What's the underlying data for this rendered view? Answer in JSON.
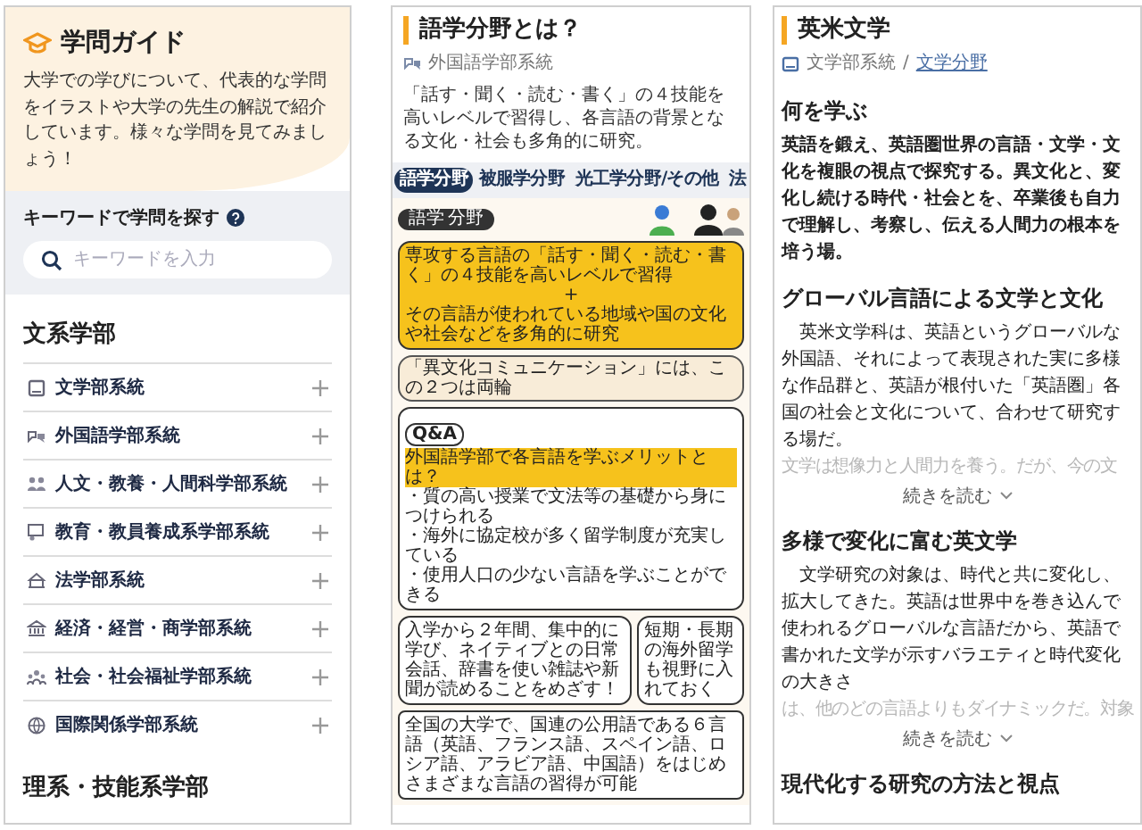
{
  "guide_panel": {
    "title": "学問ガイド",
    "description": "大学での学びについて、代表的な学問をイラストや大学の先生の解説で紹介しています。様々な学問を見てみましょう！",
    "search": {
      "label": "キーワードで学問を探す",
      "placeholder": "キーワードを入力"
    },
    "sections": [
      {
        "heading": "文系学部",
        "items": [
          {
            "label": "文学部系統",
            "expanded": false
          },
          {
            "label": "外国語学部系統",
            "expanded": false
          },
          {
            "label": "人文・教養・人間科学部系統",
            "expanded": false
          },
          {
            "label": "教育・教員養成系学部系統",
            "expanded": false
          },
          {
            "label": "法学部系統",
            "expanded": false
          },
          {
            "label": "経済・経営・商学部系統",
            "expanded": false
          },
          {
            "label": "社会・社会福祉学部系統",
            "expanded": false
          },
          {
            "label": "国際関係学部系統",
            "expanded": false
          }
        ]
      },
      {
        "heading": "理系・技能系学部"
      }
    ]
  },
  "field_panel": {
    "title": "語学分野とは？",
    "breadcrumb": "外国語学部系統",
    "description": "「話す・聞く・読む・書く」の４技能を高いレベルで習得し、各言語の背景となる文化・社会も多角的に研究。",
    "tabs": [
      {
        "label": "語学分野",
        "selected": true
      },
      {
        "label": "被服学分野",
        "selected": false
      },
      {
        "label": "光工学分野/その他",
        "selected": false
      },
      {
        "label": "法",
        "selected": false
      }
    ],
    "infographic": {
      "tag": "語学",
      "tag_suffix": "分野",
      "skill_text": "専攻する言語の「話す・聞く・読む・書く」の４技能を高いレベルで習得",
      "plus": "+",
      "culture_text": "その言語が使われている地域や国の文化や社会などを多角的に研究",
      "note": "「異文化コミュニケーション」には、この２つは両輪",
      "qa_label": "Q&A",
      "qa_question": "外国語学部で各言語を学ぶメリットとは？",
      "qa_points": [
        "・質の高い授業で文法等の基礎から身につけられる",
        "・海外に協定校が多く留学制度が充実している",
        "・使用人口の少ない言語を学ぶことができる"
      ],
      "bubbles": [
        "入学から２年間、集中的に学び、ネイティブとの日常会話、辞書を使い雑誌や新聞が読めることをめざす！",
        "短期・長期の海外留学も視野に入れておく"
      ],
      "footer": "全国の大学で、国連の公用語である６言語（英語、フランス語、スペイン語、ロシア語、アラビア語、中国語）をはじめさまざまな言語の習得が可能"
    }
  },
  "subject_panel": {
    "title": "英米文学",
    "breadcrumb": [
      {
        "label": "文学部系統",
        "link": false
      },
      {
        "label": "文学分野",
        "link": true
      }
    ],
    "separator": "/",
    "sections": [
      {
        "kind": "lead",
        "heading": "何を学ぶ",
        "text": "英語を鍛え、英語圏世界の言語・文学・文化を複眼の視点で探究する。異文化と、変化し続ける時代・社会とを、卒業後も自力で理解し、考察し、伝える人間力の根本を培う場。"
      },
      {
        "kind": "article",
        "heading": "グローバル言語による文学と文化",
        "text": "英米文学科は、英語というグローバルな外国語、それによって表現された実に多様な作品群と、英語が根付いた「英語圏」各国の社会と文化について、合わせて研究する場だ。",
        "faded": "文学は想像力と人間力を養う。だが、今の文",
        "more": "続きを読む"
      },
      {
        "kind": "article",
        "heading": "多様で変化に富む英文学",
        "text": "文学研究の対象は、時代と共に変化し、拡大してきた。英語は世界中を巻き込んで使われるグローバルな言語だから、英語で書かれた文学が示すバラエティと時代変化の大きさ",
        "faded": "は、他のどの言語よりもダイナミックだ。対象",
        "more": "続きを読む"
      },
      {
        "kind": "heading",
        "heading": "現代化する研究の方法と視点"
      }
    ]
  }
}
